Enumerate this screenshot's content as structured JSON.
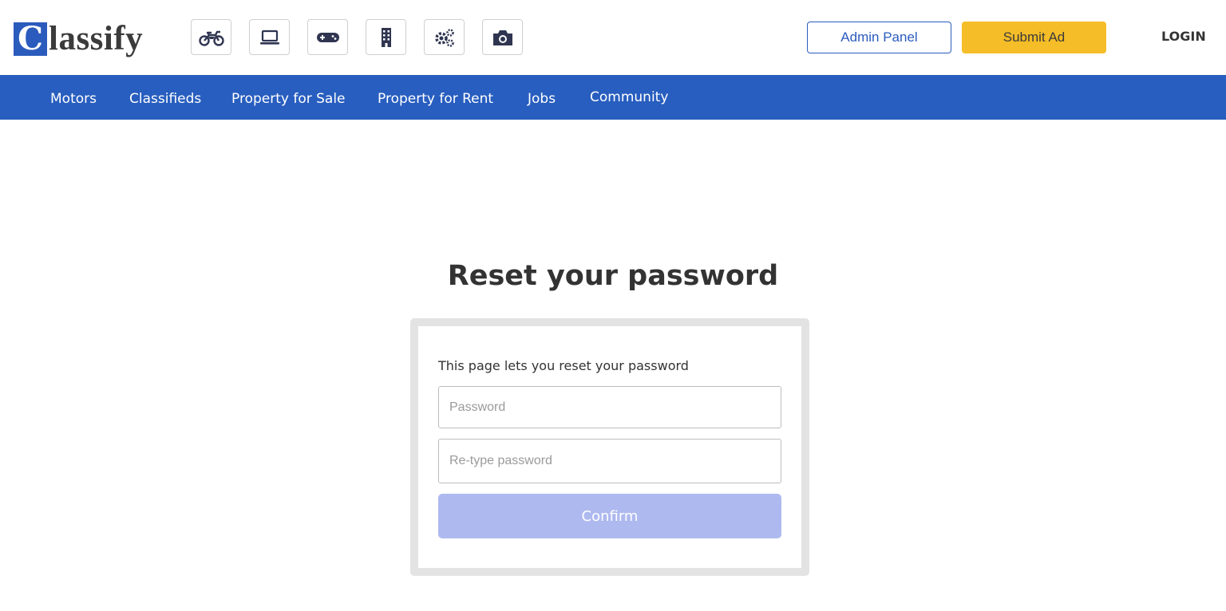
{
  "brand": {
    "logo_letter": "C",
    "logo_rest": "lassify"
  },
  "category_icons": [
    {
      "name": "motorcycle-icon"
    },
    {
      "name": "laptop-icon"
    },
    {
      "name": "gamepad-icon"
    },
    {
      "name": "building-icon"
    },
    {
      "name": "gears-icon"
    },
    {
      "name": "camera-icon"
    }
  ],
  "header": {
    "admin_label": "Admin Panel",
    "submit_label": "Submit Ad",
    "login_label": "LOGIN"
  },
  "nav": {
    "items": [
      {
        "label": "Motors"
      },
      {
        "label": "Classifieds"
      },
      {
        "label": "Property for Sale"
      },
      {
        "label": "Property for Rent"
      },
      {
        "label": "Jobs"
      },
      {
        "label": "Community"
      }
    ]
  },
  "reset": {
    "title": "Reset your password",
    "description": "This page lets you reset your password",
    "password_placeholder": "Password",
    "password_value": "",
    "retype_placeholder": "Re-type password",
    "retype_value": "",
    "confirm_label": "Confirm"
  },
  "colors": {
    "brand_blue": "#285ebf",
    "submit_yellow": "#f5bd27",
    "confirm_disabled": "#aeb9ef",
    "icon_navy": "#2f3550"
  }
}
